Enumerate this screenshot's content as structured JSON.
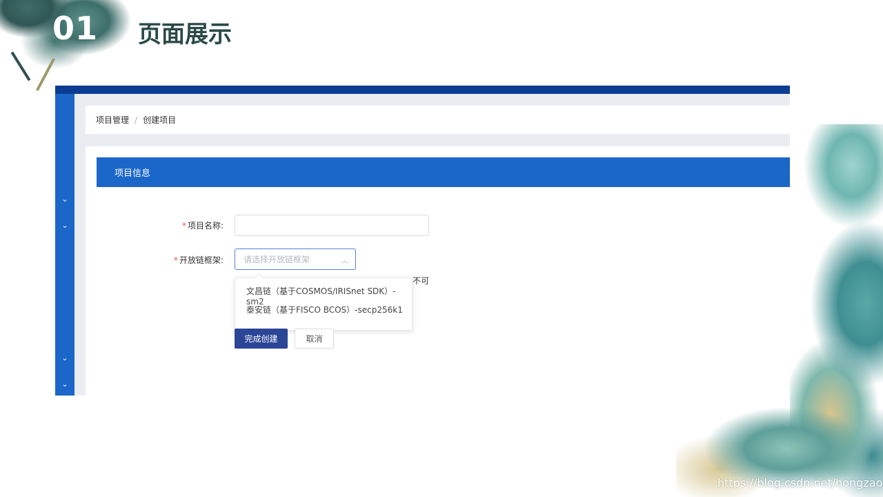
{
  "slide": {
    "number": "01",
    "title": "页面展示"
  },
  "breadcrumb": {
    "items": [
      "项目管理",
      "创建项目"
    ],
    "separator": "/"
  },
  "card": {
    "header": "项目信息"
  },
  "form": {
    "project_name_label": "项目名称:",
    "project_name_value": "",
    "framework_label": "开放链框架:",
    "framework_placeholder": "请选择开放链框架",
    "hint_tail": "不可",
    "required_mark": "*"
  },
  "dropdown": {
    "options": [
      "文昌链（基于COSMOS/IRISnet SDK）-sm2",
      "泰安链（基于FISCO BCOS）-secp256k1"
    ]
  },
  "buttons": {
    "submit": "完成创建",
    "cancel": "取消"
  },
  "sidebar": {
    "chevrons": [
      "⌄",
      "⌄",
      "⌄",
      "⌄"
    ]
  },
  "watermark": "https://blog.csdn.net/hongzaokeji",
  "colors": {
    "primary": "#1b66c9",
    "topbar": "#0a3d91",
    "submit": "#2b4597",
    "required": "#e84e4e"
  }
}
